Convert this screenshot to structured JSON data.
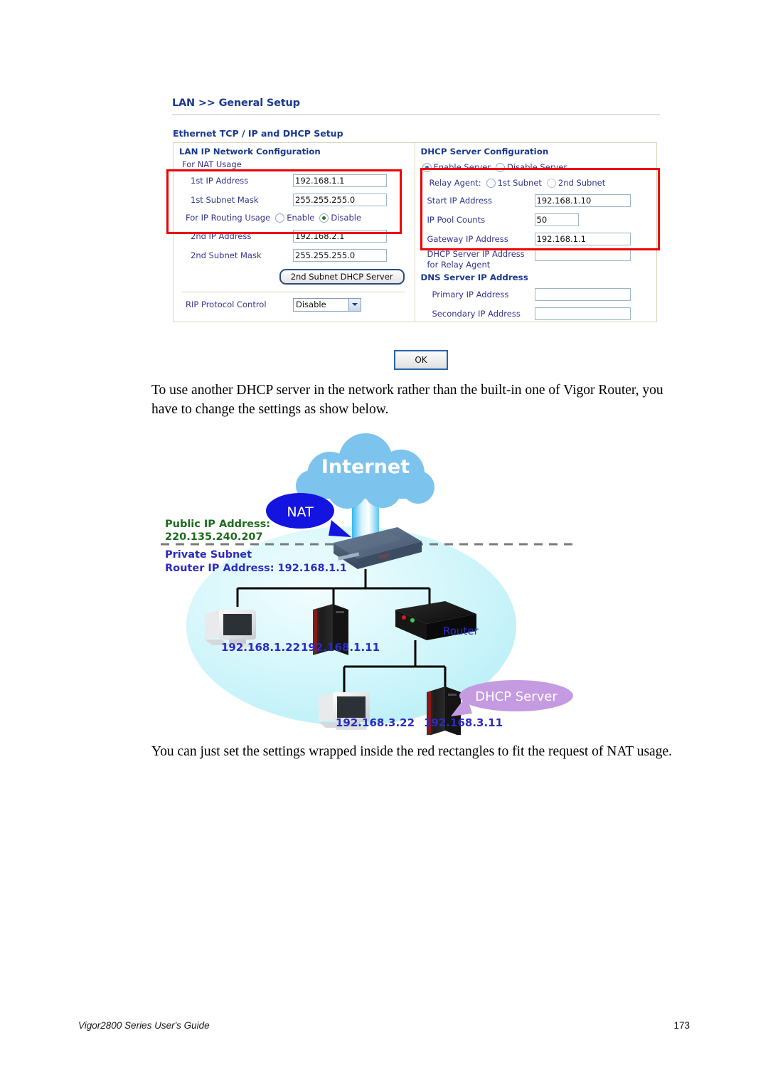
{
  "screenshot": {
    "page_title": "LAN >> General Setup",
    "section_title": "Ethernet TCP / IP and DHCP Setup",
    "left_panel": {
      "heading": "LAN IP Network Configuration",
      "nat_usage_label": "For NAT Usage",
      "first_ip_label": "1st IP Address",
      "first_ip_value": "192.168.1.1",
      "first_mask_label": "1st Subnet Mask",
      "first_mask_value": "255.255.255.0",
      "routing_usage_label": "For IP Routing Usage",
      "routing_enable_label": "Enable",
      "routing_disable_label": "Disable",
      "routing_selected": "Disable",
      "second_ip_label": "2nd IP Address",
      "second_ip_value": "192.168.2.1",
      "second_mask_label": "2nd Subnet Mask",
      "second_mask_value": "255.255.255.0",
      "second_subnet_button": "2nd Subnet DHCP Server",
      "rip_label": "RIP Protocol Control",
      "rip_value": "Disable"
    },
    "right_panel": {
      "heading": "DHCP Server Configuration",
      "enable_server_label": "Enable Server",
      "disable_server_label": "Disable Server",
      "server_selected": "Enable Server",
      "relay_agent_label": "Relay Agent:",
      "relay_first_subnet_label": "1st Subnet",
      "relay_second_subnet_label": "2nd Subnet",
      "start_ip_label": "Start IP Address",
      "start_ip_value": "192.168.1.10",
      "pool_counts_label": "IP Pool Counts",
      "pool_counts_value": "50",
      "gateway_label": "Gateway IP Address",
      "gateway_value": "192.168.1.1",
      "relay_server_label_line1": "DHCP Server IP Address",
      "relay_server_label_line2": "for Relay Agent",
      "relay_server_value": "",
      "dns_heading": "DNS Server IP Address",
      "primary_dns_label": "Primary IP Address",
      "primary_dns_value": "",
      "secondary_dns_label": "Secondary IP Address",
      "secondary_dns_value": ""
    },
    "ok_button": "OK",
    "highlight_color": "#ee0000"
  },
  "body": {
    "paragraph_1": "To use another DHCP server in the network rather than the built-in one of Vigor Router, you have to change the settings as show below.",
    "paragraph_2": "You can just set the settings wrapped inside the red rectangles to fit the request of NAT usage."
  },
  "diagram": {
    "internet_label": "Internet",
    "nat_label": "NAT",
    "dhcp_server_label": "DHCP Server",
    "public_ip_caption": "Public IP Address:",
    "public_ip_value": "220.135.240.207",
    "private_subnet_caption": "Private Subnet",
    "router_ip_caption": "Router IP Address: 192.168.1.1",
    "host_1_ip": "192.168.1.22",
    "host_2_ip": "192.168.1.11",
    "router_label": "Router",
    "host_3_ip": "192.168.3.22",
    "host_4_ip": "192.168.3.11",
    "colors": {
      "cloud": "#7cc3ee",
      "nat_bubble": "#1414e0",
      "dhcp_bubble": "#c49ae0",
      "subnet_ellipse": "#ccf4fa",
      "public_text": "#1d6b1d",
      "private_text": "#2b2bbf"
    }
  },
  "footer": {
    "guide_title": "Vigor2800 Series User's Guide",
    "page_number": "173"
  }
}
